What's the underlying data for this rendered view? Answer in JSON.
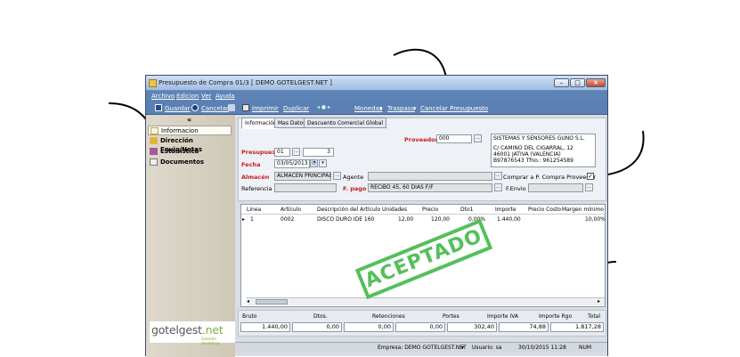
{
  "window": {
    "title": "Presupuesto de Compra 01/3 [ DEMO GOTELGEST.NET ]"
  },
  "menu": {
    "archivo": "Archivo",
    "edicion": "Edicion",
    "ver": "Ver",
    "ayuda": "Ayuda"
  },
  "toolbar": {
    "guardar": "Guardar",
    "cancelar": "Cancelar",
    "imprimir": "Imprimir",
    "duplicar": "Duplicar",
    "monedas": "Monedas",
    "traspaso": "Traspaso",
    "cancelar_presupuesto": "Cancelar Presupuesto"
  },
  "sidebar": {
    "collapse": "«",
    "items": [
      {
        "label": "Informacion"
      },
      {
        "label": "Dirección Envio/Notas"
      },
      {
        "label": "Estadística"
      },
      {
        "label": "Documentos"
      }
    ]
  },
  "logo": {
    "brand_a": "gotelgest",
    "brand_b": ".net",
    "tagline": "Gestión dinámica"
  },
  "tabs": [
    "Información",
    "Mas Datos",
    "Descuento Comercial Global"
  ],
  "form": {
    "proveedor_label": "Proveedor",
    "proveedor_code": "000",
    "address": [
      "SISTEMAS Y SENSORES GUNO S.L.",
      "",
      "C/ CAMINO DEL CIGARRAL, 12",
      "46001 JATIVA (VALENCIA)",
      "B97876543   Tfno.: 961254589"
    ],
    "presupuesto_label": "Presupuest",
    "presupuesto_serie": "01",
    "presupuesto_num": "3",
    "fecha_label": "Fecha",
    "fecha_value": "03/05/2013",
    "almacen_label": "Almacén",
    "almacen_value": "ALMACEN PRINCIPAL",
    "agente_label": "Agente",
    "comprar_label": "Comprar a P. Compra Proveedor",
    "referencia_label": "Referencia",
    "fpago_label": "F. pago",
    "fpago_value": "RECIBO 45, 60 DIAS F/F",
    "fenvio_label": "F.Envio"
  },
  "grid": {
    "headers": [
      "Linea",
      "Artículo",
      "Descripción del Artículo",
      "Unidades",
      "Precio",
      "Dto1",
      "Importe",
      "Precio Costo",
      "Margen mínimo"
    ],
    "rows": [
      [
        "1",
        "0002",
        "DISCO DURO IDE 160",
        "12,00",
        "120,00",
        "0,00%",
        "1.440,00",
        "",
        "10,00%"
      ]
    ],
    "stamp": "ACEPTADO"
  },
  "totals": {
    "labels": [
      "Bruto",
      "Dtos.",
      "Retenciones",
      "Portes",
      "Importe IVA",
      "Importe Rgo",
      "Total"
    ],
    "values": [
      "1.440,00",
      "0,00",
      "0,00",
      "0,00",
      "302,40",
      "74,88",
      "1.817,28"
    ]
  },
  "status": {
    "empresa": "Empresa: DEMO GOTELGEST.NET",
    "usuario": "Usuario: sa",
    "fecha": "30/10/2015 11:28",
    "num": "NUM"
  }
}
